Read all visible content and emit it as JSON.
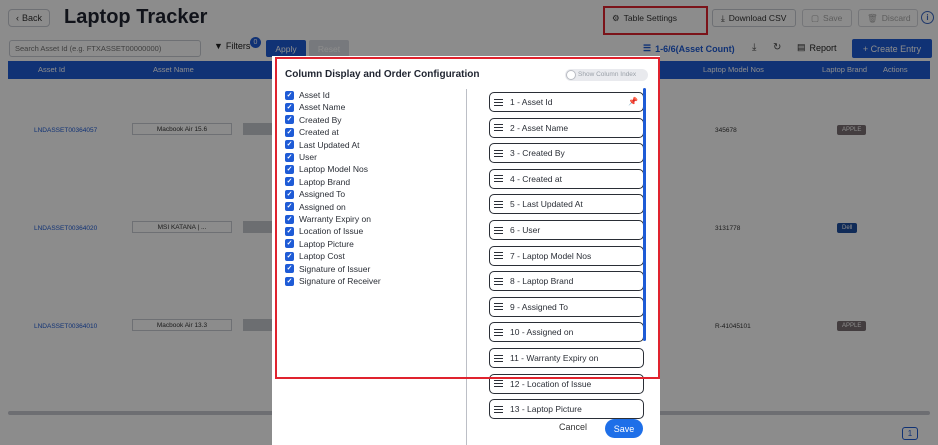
{
  "header": {
    "back_label": "Back",
    "title": "Laptop Tracker",
    "table_settings_label": "Table Settings",
    "download_csv_label": "Download CSV",
    "save_label": "Save",
    "discard_label": "Discard"
  },
  "filters": {
    "search_placeholder": "Search Asset Id (e.g. FTXASSET00000000)",
    "filters_label": "Filters",
    "filters_count": "0",
    "apply_label": "Apply",
    "reset_label": "Reset",
    "count_label": "1-6/6(Asset Count)",
    "report_label": "Report",
    "create_label": "+ Create Entry"
  },
  "table": {
    "columns": [
      "Asset Id",
      "Asset Name",
      "Laptop Model Nos",
      "Laptop Brand",
      "Actions"
    ],
    "rows": [
      {
        "asset_id": "LNDASSET00364057",
        "asset_name": "Macbook Air 15.6",
        "model": "345678",
        "brand": "APPLE",
        "brand_color": "#7b6f73"
      },
      {
        "asset_id": "LNDASSET00364020",
        "asset_name": "MSI KATANA | ...",
        "model": "3131778",
        "brand": "Dell",
        "brand_color": "#1e4fa0"
      },
      {
        "asset_id": "LNDASSET00364010",
        "asset_name": "Macbook Air 13.3",
        "model": "R-41045101",
        "brand": "APPLE",
        "brand_color": "#7b6f73"
      }
    ],
    "page": "1"
  },
  "modal": {
    "title": "Column Display and Order Configuration",
    "toggle_label": "Show Column Index",
    "columns": [
      "Asset Id",
      "Asset Name",
      "Created By",
      "Created at",
      "Last Updated At",
      "User",
      "Laptop Model Nos",
      "Laptop Brand",
      "Assigned To",
      "Assigned on",
      "Warranty Expiry on",
      "Location of Issue",
      "Laptop Picture",
      "Laptop Cost",
      "Signature of Issuer",
      "Signature of Receiver"
    ],
    "order": [
      "1 - Asset Id",
      "2 - Asset Name",
      "3 - Created By",
      "4 - Created at",
      "5 - Last Updated At",
      "6 - User",
      "7 - Laptop Model Nos",
      "8 - Laptop Brand",
      "9 - Assigned To",
      "10 - Assigned on",
      "11 - Warranty Expiry on",
      "12 - Location of Issue",
      "13 - Laptop Picture"
    ],
    "cancel_label": "Cancel",
    "save_label": "Save"
  },
  "colors": {
    "accent": "#1e5bd6",
    "highlight": "#e0232e"
  }
}
